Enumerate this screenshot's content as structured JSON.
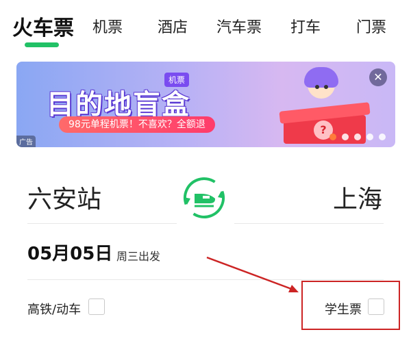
{
  "tabs": [
    {
      "label": "火车票",
      "active": true
    },
    {
      "label": "机票",
      "active": false
    },
    {
      "label": "酒店",
      "active": false
    },
    {
      "label": "汽车票",
      "active": false
    },
    {
      "label": "打车",
      "active": false
    },
    {
      "label": "门票",
      "active": false
    }
  ],
  "banner": {
    "tag": "机票",
    "headline": "目的地盲盒",
    "subtitle": "98元单程机票！不喜欢？全额退",
    "ad_label": "广告",
    "close_icon": "close-icon",
    "slides": 5,
    "active_slide": 0
  },
  "route": {
    "from": "六安站",
    "to": "上海",
    "swap_icon": "train-swap-icon"
  },
  "date": {
    "value": "05月05日",
    "weekday": "周三出发"
  },
  "options": {
    "high_speed_label": "高铁/动车",
    "high_speed_checked": false,
    "student_label": "学生票",
    "student_checked": false
  },
  "colors": {
    "accent_green": "#21c166",
    "annotation_red": "#cc2424"
  }
}
